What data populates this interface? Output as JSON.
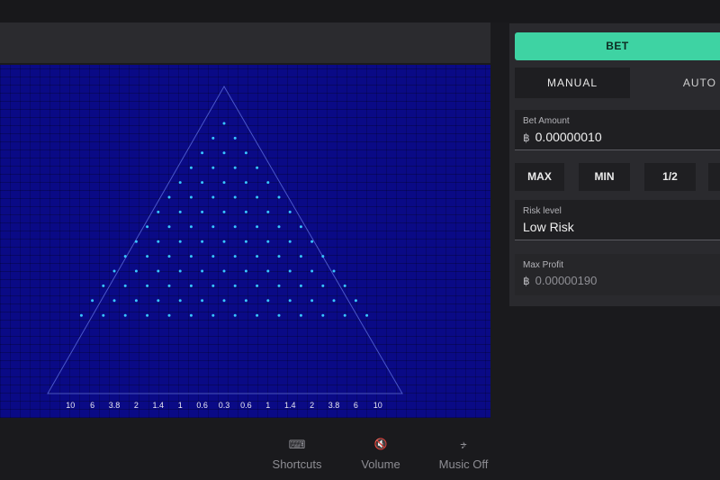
{
  "header": {},
  "board": {
    "rows": 14,
    "first_row_pegs": 1,
    "multipliers": [
      "10",
      "6",
      "3.8",
      "2",
      "1.4",
      "1",
      "0.6",
      "0.3",
      "0.6",
      "1",
      "1.4",
      "2",
      "3.8",
      "6",
      "10"
    ],
    "colors": {
      "background": "#0a0a86",
      "peg": "#38c6ff",
      "triangle": "#4a57c9",
      "label": "#e8e8f0"
    }
  },
  "sidebar": {
    "bet_button": "BET",
    "tabs": [
      "MANUAL",
      "AUTO"
    ],
    "bet_amount": {
      "label": "Bet Amount",
      "currency_icon": "bitcoin-icon",
      "currency_symbol": "฿",
      "value": "0.00000010"
    },
    "quick_buttons": [
      "MAX",
      "MIN",
      "1/2"
    ],
    "risk_level": {
      "label": "Risk level",
      "value": "Low Risk"
    },
    "max_profit": {
      "label": "Max Profit",
      "currency_icon": "bitcoin-icon",
      "currency_symbol": "฿",
      "value": "0.00000190"
    },
    "accent_color": "#3ed3a3"
  },
  "footer": {
    "shortcuts": {
      "label": "Shortcuts",
      "icon": "keyboard-icon",
      "glyph": "⌨"
    },
    "volume": {
      "label": "Volume",
      "icon": "volume-muted-icon",
      "glyph": "🔇"
    },
    "music": {
      "label": "Music Off",
      "icon": "music-off-icon",
      "glyph": "♪"
    }
  }
}
